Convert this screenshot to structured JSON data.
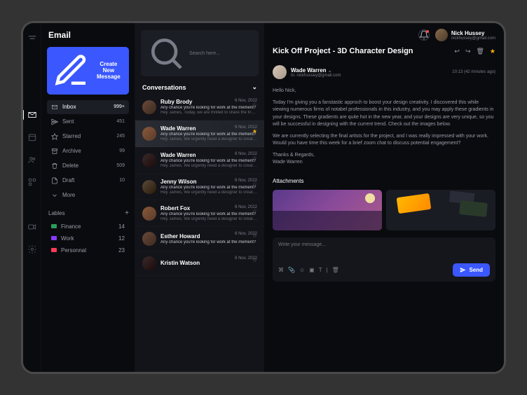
{
  "brand": "Email",
  "new_message": "Create New Message",
  "search": {
    "placeholder": "Search here..."
  },
  "folders": [
    {
      "icon": "inbox",
      "label": "Inbox",
      "count": "999+",
      "active": true
    },
    {
      "icon": "sent",
      "label": "Sent",
      "count": "451"
    },
    {
      "icon": "star",
      "label": "Starred",
      "count": "245"
    },
    {
      "icon": "archive",
      "label": "Archive",
      "count": "99"
    },
    {
      "icon": "trash",
      "label": "Delete",
      "count": "509"
    },
    {
      "icon": "draft",
      "label": "Draft",
      "count": "10"
    },
    {
      "icon": "more",
      "label": "More",
      "count": ""
    }
  ],
  "labels_header": "Lables",
  "labels": [
    {
      "name": "Finance",
      "color": "#2a9d5a",
      "count": "14"
    },
    {
      "name": "Work",
      "color": "#8a3aff",
      "count": "12"
    },
    {
      "name": "Personnal",
      "color": "#ff3a5a",
      "count": "23"
    }
  ],
  "conversations_header": "Conversations",
  "conversations": [
    {
      "name": "Ruby Brody",
      "date": "6 Nov, 2022",
      "q": "Any chance you're looking for work at the mement?",
      "preview": "Hey James, Today, we are thrilled to share the first...",
      "starred": false,
      "avatar": "av1"
    },
    {
      "name": "Wade Warren",
      "date": "6 Nov, 2022",
      "q": "Any chance you're looking for work at the mement?",
      "preview": "Hey James, We urgently need a designer to create a...",
      "starred": true,
      "avatar": "av2",
      "selected": true
    },
    {
      "name": "Wade Warren",
      "date": "6 Nov, 2022",
      "q": "Any chance you're looking for work at the mement?",
      "preview": "Hey James, We urgently need a designer to create a...",
      "starred": false,
      "avatar": "av3"
    },
    {
      "name": "Jenny Wilson",
      "date": "6 Nov, 2022",
      "q": "Any chance you're looking for work at the mement?",
      "preview": "Hey James, We urgently need a designer to create a...",
      "starred": false,
      "avatar": "av4"
    },
    {
      "name": "Robert Fox",
      "date": "6 Nov, 2022",
      "q": "Any chance you're looking for work at the mement?",
      "preview": "Hey James, We urgently need a designer to create a...",
      "starred": false,
      "avatar": "av2"
    },
    {
      "name": "Esther Howard",
      "date": "6 Nov, 2022",
      "q": "Any chance you're looking for work at the mement?",
      "preview": "",
      "starred": false,
      "avatar": "av1"
    },
    {
      "name": "Kristin Watson",
      "date": "6 Nov, 2022",
      "q": "",
      "preview": "",
      "starred": false,
      "avatar": "av3"
    }
  ],
  "user": {
    "name": "Nick Hussey",
    "email": "nickhussey@gmail.com"
  },
  "mail": {
    "subject": "Kick Off Project - 3D Character Design",
    "sender": "Wade Warren",
    "to": "to: nickhussey@gmail.com",
    "time": "10:13 (42 minutes ago)",
    "greeting": "Hello Nick,",
    "p1": "Today I'm giving you a fanstastic approch to boost your design creativity. I discovered this while viewing numerous firms of notabel professionals in this industry, and you may apply these gradients in your designs. These gradients are quite hot in the new year, and your designs are very unique, so you will be successful in designing with the current trend. Check out the images below.",
    "p2": "We are currently selecting the final artists for the project, and I was really impressed with your work. Would you have time this week for a brief zoom chat to discuss potential engagement?",
    "closing": "Thanks & Regards,",
    "signature": "Wade Warren",
    "attachments_label": "Attachments"
  },
  "compose": {
    "placeholder": "Write your message..."
  },
  "send_label": "Send"
}
